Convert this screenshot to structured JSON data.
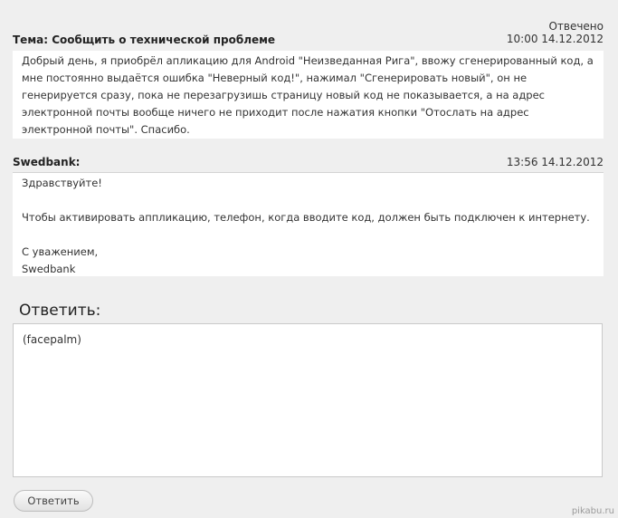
{
  "ticket": {
    "subject": "Тема: Сообщить о технической проблеме",
    "status": "Отвечено",
    "datetime": "10:00 14.12.2012",
    "body": "Добрый день, я приобрёл апликацию для Android \"Неизведанная Рига\", ввожу сгенерированный код, а мне постоянно выдаётся ошибка \"Неверный код!\", нажимал \"Сгенерировать новый\", он не генерируется сразу, пока не перезагрузишь страницу новый код не показывается, а на адрес электронной почты вообще ничего не приходит после нажатия кнопки \"Отослать на адрес электронной почты\". Спасибо."
  },
  "reply": {
    "author": "Swedbank:",
    "datetime": "13:56 14.12.2012",
    "greeting": "Здравствуйте!",
    "body": "Чтобы активировать аппликацию, телефон, когда вводите код, должен быть подключен к интернету.",
    "closing": "С уважением,",
    "signature": "Swedbank"
  },
  "answer_form": {
    "heading": "Ответить:",
    "textarea_value": "(facepalm)",
    "submit_label": "Ответить"
  },
  "watermark": "pikabu.ru"
}
